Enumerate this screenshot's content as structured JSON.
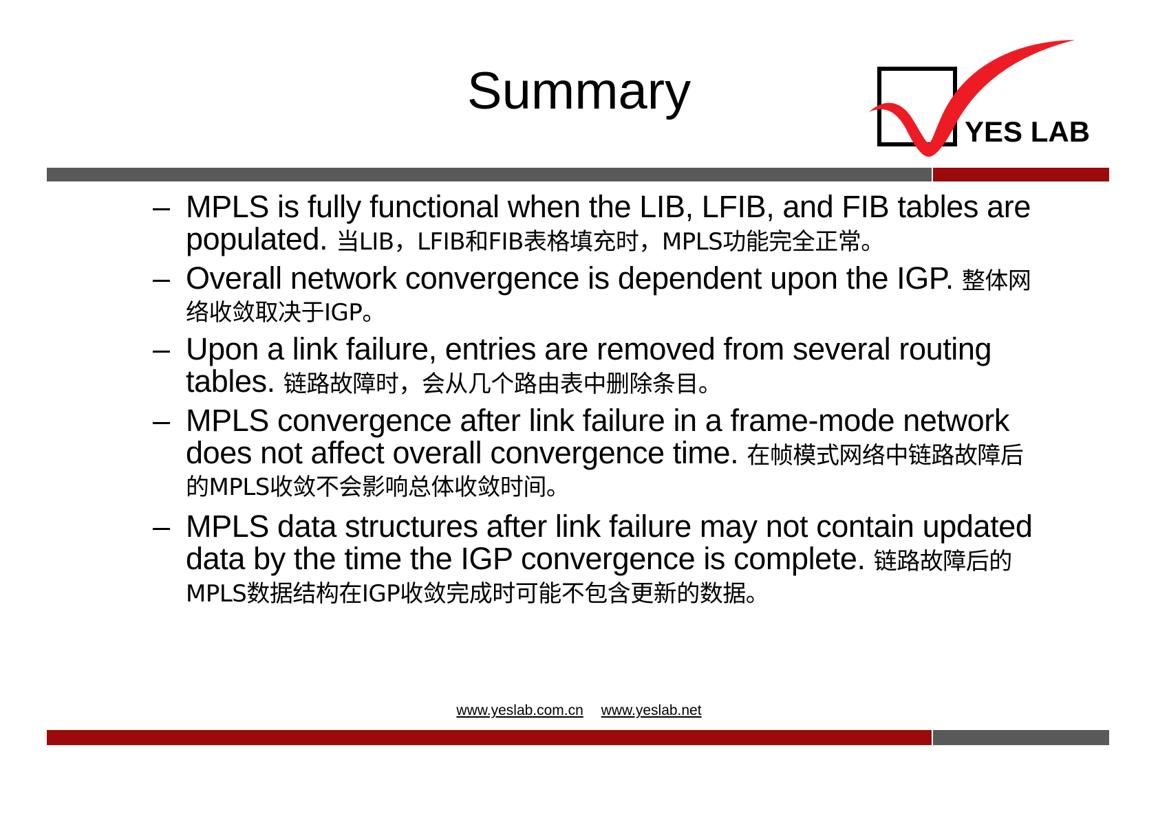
{
  "slide": {
    "title": "Summary",
    "colors": {
      "gray_bar": "#595959",
      "red_bar": "#9C0B0B",
      "logo_red": "#ED1C24",
      "text": "#000000",
      "background": "#FFFFFF"
    }
  },
  "logo": {
    "name": "yes-lab-logo",
    "text": "YES LAB"
  },
  "bullets": [
    {
      "marker": "–",
      "en": "MPLS is fully functional when the LIB, LFIB, and FIB tables are populated.",
      "zh": "当LIB，LFIB和FIB表格填充时，MPLS功能完全正常。"
    },
    {
      "marker": "–",
      "en": "Overall network convergence is dependent upon the IGP.",
      "zh": "整体网络收敛取决于IGP。"
    },
    {
      "marker": "–",
      "en": "Upon a link failure, entries are removed from several routing tables.",
      "zh": "链路故障时，会从几个路由表中删除条目。"
    },
    {
      "marker": "–",
      "en": "MPLS convergence after link failure in a frame-mode network does not affect overall convergence time.",
      "zh": "在帧模式网络中链路故障后的MPLS收敛不会影响总体收敛时间。"
    },
    {
      "marker": "–",
      "en": "MPLS data structures after link failure may not contain updated data by the time the IGP convergence is complete.",
      "zh": "链路故障后的MPLS数据结构在IGP收敛完成时可能不包含更新的数据。"
    }
  ],
  "footer": {
    "link1": "www.yeslab.com.cn",
    "link2": "www.yeslab.net"
  }
}
